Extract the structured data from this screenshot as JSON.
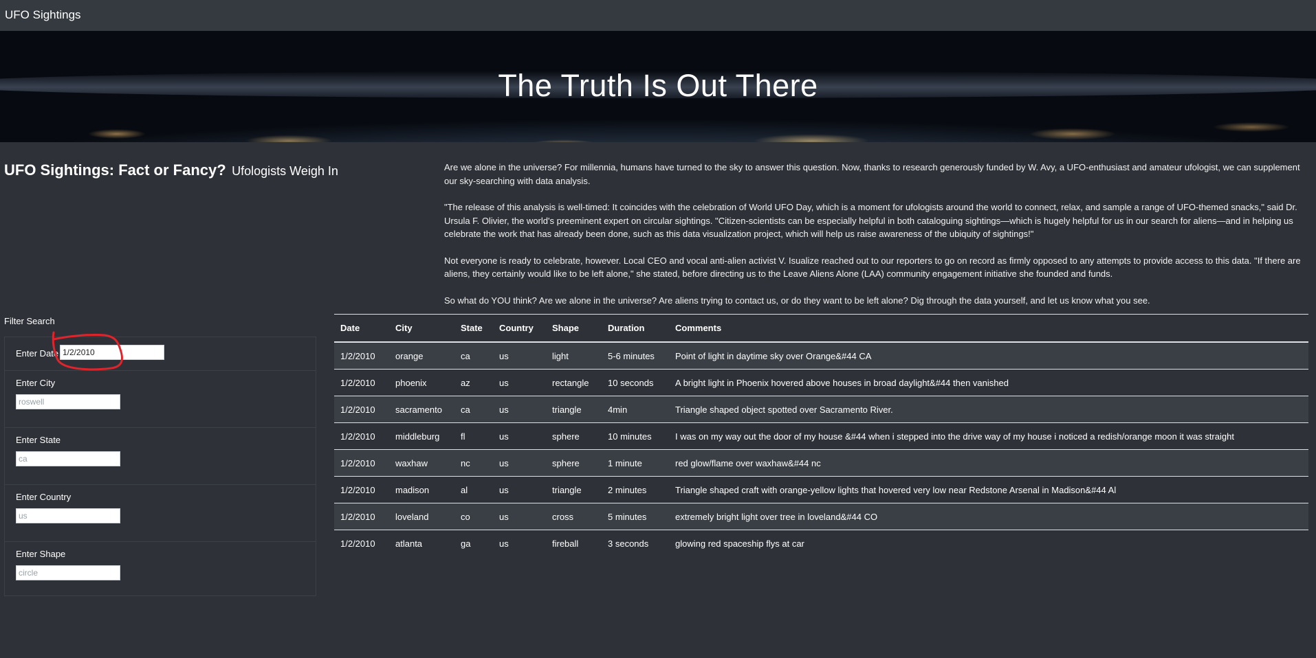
{
  "navbar": {
    "brand": "UFO Sightings"
  },
  "hero": {
    "title": "The Truth Is Out There"
  },
  "article": {
    "heading": "UFO Sightings: Fact or Fancy?",
    "subheading": "Ufologists Weigh In",
    "paragraphs": [
      "Are we alone in the universe? For millennia, humans have turned to the sky to answer this question. Now, thanks to research generously funded by W. Avy, a UFO-enthusiast and amateur ufologist, we can supplement our sky-searching with data analysis.",
      "\"The release of this analysis is well-timed: It coincides with the celebration of World UFO Day, which is a moment for ufologists around the world to connect, relax, and sample a range of UFO-themed snacks,\" said Dr. Ursula F. Olivier, the world's preeminent expert on circular sightings. \"Citizen-scientists can be especially helpful in both cataloguing sightings—which is hugely helpful for us in our search for aliens—and in helping us celebrate the work that has already been done, such as this data visualization project, which will help us raise awareness of the ubiquity of sightings!\"",
      "Not everyone is ready to celebrate, however. Local CEO and vocal anti-alien activist V. Isualize reached out to our reporters to go on record as firmly opposed to any attempts to provide access to this data. \"If there are aliens, they certainly would like to be left alone,\" she stated, before directing us to the Leave Aliens Alone (LAA) community engagement initiative she founded and funds.",
      "So what do YOU think? Are we alone in the universe? Are aliens trying to contact us, or do they want to be left alone? Dig through the data yourself, and let us know what you see."
    ]
  },
  "filters": {
    "title": "Filter Search",
    "date": {
      "label": "Enter Date",
      "value": "1/2/2010",
      "placeholder": ""
    },
    "city": {
      "label": "Enter City",
      "value": "",
      "placeholder": "roswell"
    },
    "state": {
      "label": "Enter State",
      "value": "",
      "placeholder": "ca"
    },
    "country": {
      "label": "Enter Country",
      "value": "",
      "placeholder": "us"
    },
    "shape": {
      "label": "Enter Shape",
      "value": "",
      "placeholder": "circle"
    }
  },
  "annotation_color": "#e0242b",
  "table": {
    "columns": [
      "Date",
      "City",
      "State",
      "Country",
      "Shape",
      "Duration",
      "Comments"
    ],
    "rows": [
      [
        "1/2/2010",
        "orange",
        "ca",
        "us",
        "light",
        "5-6 minutes",
        "Point of light in daytime sky over Orange&#44 CA"
      ],
      [
        "1/2/2010",
        "phoenix",
        "az",
        "us",
        "rectangle",
        "10 seconds",
        "A bright light in Phoenix hovered above houses in broad daylight&#44 then vanished"
      ],
      [
        "1/2/2010",
        "sacramento",
        "ca",
        "us",
        "triangle",
        "4min",
        "Triangle shaped object spotted over Sacramento River."
      ],
      [
        "1/2/2010",
        "middleburg",
        "fl",
        "us",
        "sphere",
        "10 minutes",
        "I was on my way out the door of my house &#44 when i stepped into the drive way of my house i noticed a redish/orange moon it was straight"
      ],
      [
        "1/2/2010",
        "waxhaw",
        "nc",
        "us",
        "sphere",
        "1 minute",
        "red glow/flame over waxhaw&#44 nc"
      ],
      [
        "1/2/2010",
        "madison",
        "al",
        "us",
        "triangle",
        "2 minutes",
        "Triangle shaped craft with orange-yellow lights that hovered very low near Redstone Arsenal in Madison&#44 Al"
      ],
      [
        "1/2/2010",
        "loveland",
        "co",
        "us",
        "cross",
        "5 minutes",
        "extremely bright light over tree in loveland&#44 CO"
      ],
      [
        "1/2/2010",
        "atlanta",
        "ga",
        "us",
        "fireball",
        "3 seconds",
        "glowing red spaceship flys at car"
      ]
    ]
  }
}
